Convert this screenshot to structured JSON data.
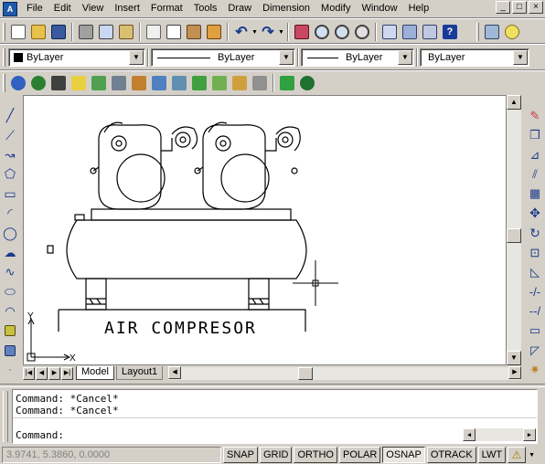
{
  "menu": [
    "File",
    "Edit",
    "View",
    "Insert",
    "Format",
    "Tools",
    "Draw",
    "Dimension",
    "Modify",
    "Window",
    "Help"
  ],
  "window_controls": [
    "_",
    "□",
    "×"
  ],
  "properties": {
    "layer_value": "ByLayer",
    "linetype_value": "ByLayer",
    "lineweight_value": "ByLayer",
    "plotstyle_value": "ByLayer"
  },
  "drawing": {
    "title_text": "AIR COMPRESOR",
    "ucs_x": "X",
    "ucs_y": "Y"
  },
  "tabs": {
    "model": "Model",
    "layout1": "Layout1",
    "nav": [
      "|◀",
      "◀",
      "▶",
      "▶|"
    ]
  },
  "command": {
    "lines": [
      "Command: *Cancel*",
      "Command: *Cancel*"
    ],
    "prompt": "Command:"
  },
  "status": {
    "coords": "3.9741, 5.3860, 0.0000",
    "toggles": [
      "SNAP",
      "GRID",
      "ORTHO",
      "POLAR",
      "OSNAP",
      "OTRACK",
      "LWT"
    ],
    "active_toggle": "OSNAP"
  },
  "colors": {
    "chrome": "#d4d0c8",
    "canvas": "#ffffff",
    "drawing_lines": "#000000"
  }
}
